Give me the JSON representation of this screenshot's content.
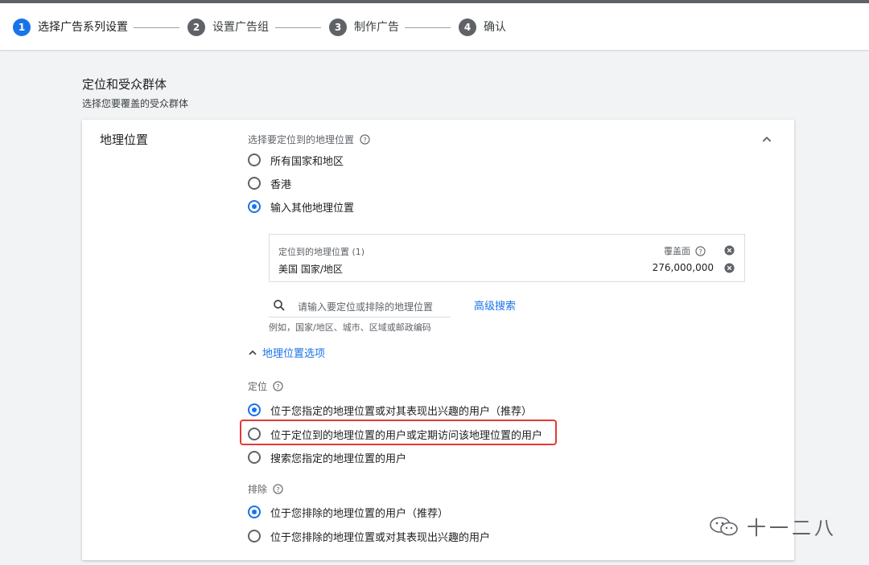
{
  "stepper": {
    "steps": [
      {
        "number": "1",
        "label": "选择广告系列设置",
        "active": true
      },
      {
        "number": "2",
        "label": "设置广告组",
        "active": false
      },
      {
        "number": "3",
        "label": "制作广告",
        "active": false
      },
      {
        "number": "4",
        "label": "确认",
        "active": false
      }
    ]
  },
  "section": {
    "title": "定位和受众群体",
    "subtitle": "选择您要覆盖的受众群体"
  },
  "geo": {
    "label": "地理位置",
    "prompt": "选择要定位到的地理位置",
    "options": [
      {
        "label": "所有国家和地区",
        "checked": false
      },
      {
        "label": "香港",
        "checked": false
      },
      {
        "label": "输入其他地理位置",
        "checked": true
      }
    ],
    "targeted": {
      "header": "定位到的地理位置 (1)",
      "reach_label": "覆盖面",
      "items": [
        {
          "name": "美国 国家/地区",
          "reach": "276,000,000"
        }
      ]
    },
    "search": {
      "placeholder": "请输入要定位或排除的地理位置",
      "hint": "例如，国家/地区、城市、区域或邮政编码",
      "advanced_link": "高级搜索"
    },
    "options_toggle": "地理位置选项",
    "targeting": {
      "label": "定位",
      "options": [
        {
          "label": "位于您指定的地理位置或对其表现出兴趣的用户（推荐）",
          "checked": true
        },
        {
          "label": "位于定位到的地理位置的用户或定期访问该地理位置的用户",
          "checked": false
        },
        {
          "label": "搜索您指定的地理位置的用户",
          "checked": false
        }
      ]
    },
    "exclusion": {
      "label": "排除",
      "options": [
        {
          "label": "位于您排除的地理位置的用户（推荐）",
          "checked": true
        },
        {
          "label": "位于您排除的地理位置或对其表现出兴趣的用户",
          "checked": false
        }
      ]
    }
  },
  "watermark": {
    "text": "十一二八"
  },
  "colors": {
    "accent": "#1a73e8",
    "highlight": "#e53935",
    "text": "#202124",
    "muted": "#5f6368"
  }
}
